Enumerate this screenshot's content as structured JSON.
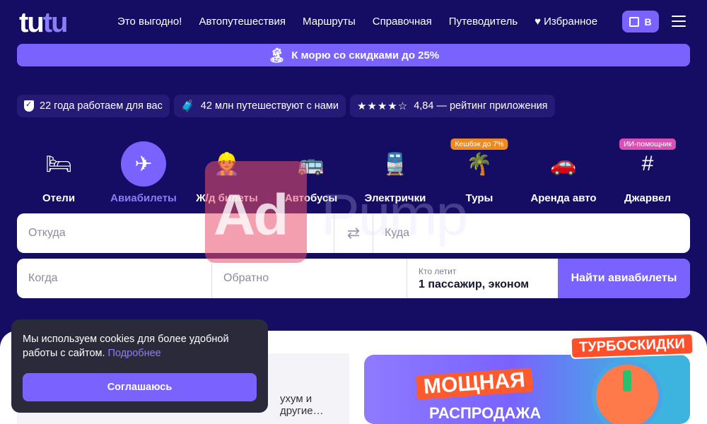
{
  "header": {
    "logo": "tutu",
    "nav": [
      "Это выгодно!",
      "Автопутешествия",
      "Маршруты",
      "Справочная",
      "Путеводитель",
      "Избранное"
    ],
    "login_label": "В"
  },
  "promo": {
    "text": "К морю со скидками до 25%"
  },
  "badges": [
    "22 года работаем для вас",
    "42 млн путешествуют с нами",
    "4,84 — рейтинг приложения"
  ],
  "categories": [
    {
      "label": "Отели",
      "icon": "bed-icon",
      "tag": ""
    },
    {
      "label": "Авиабилеты",
      "icon": "plane-icon",
      "tag": ""
    },
    {
      "label": "Ж/д билеты",
      "icon": "conductor-icon",
      "tag": ""
    },
    {
      "label": "Автобусы",
      "icon": "bus-icon",
      "tag": ""
    },
    {
      "label": "Электрички",
      "icon": "train-icon",
      "tag": ""
    },
    {
      "label": "Туры",
      "icon": "palm-icon",
      "tag": "Кешбэк до 7%"
    },
    {
      "label": "Аренда авто",
      "icon": "car-icon",
      "tag": ""
    },
    {
      "label": "Джарвел",
      "icon": "hash-icon",
      "tag": "ИИ-помощник"
    }
  ],
  "search": {
    "from_placeholder": "Откуда",
    "to_placeholder": "Куда",
    "when_placeholder": "Когда",
    "back_placeholder": "Обратно",
    "who_label": "Кто летит",
    "who_value": "1 пассажир, эконом",
    "submit": "Найти авиабилеты"
  },
  "lower": {
    "snippet": "ухум и другие…"
  },
  "banner": {
    "sticker": "ТУРБОСКИДКИ",
    "line1": "МОЩНАЯ",
    "line2": "РАСПРОДАЖА"
  },
  "cookie": {
    "message": "Мы используем cookies для более удобной работы с сайтом.",
    "more": "Подробнее",
    "accept": "Соглашаюсь"
  },
  "watermark": {
    "left": "Ad",
    "right": "Pump"
  },
  "colors": {
    "background": "#150d63",
    "accent": "#7a62ff",
    "accent_text": "#8b7cf8"
  }
}
